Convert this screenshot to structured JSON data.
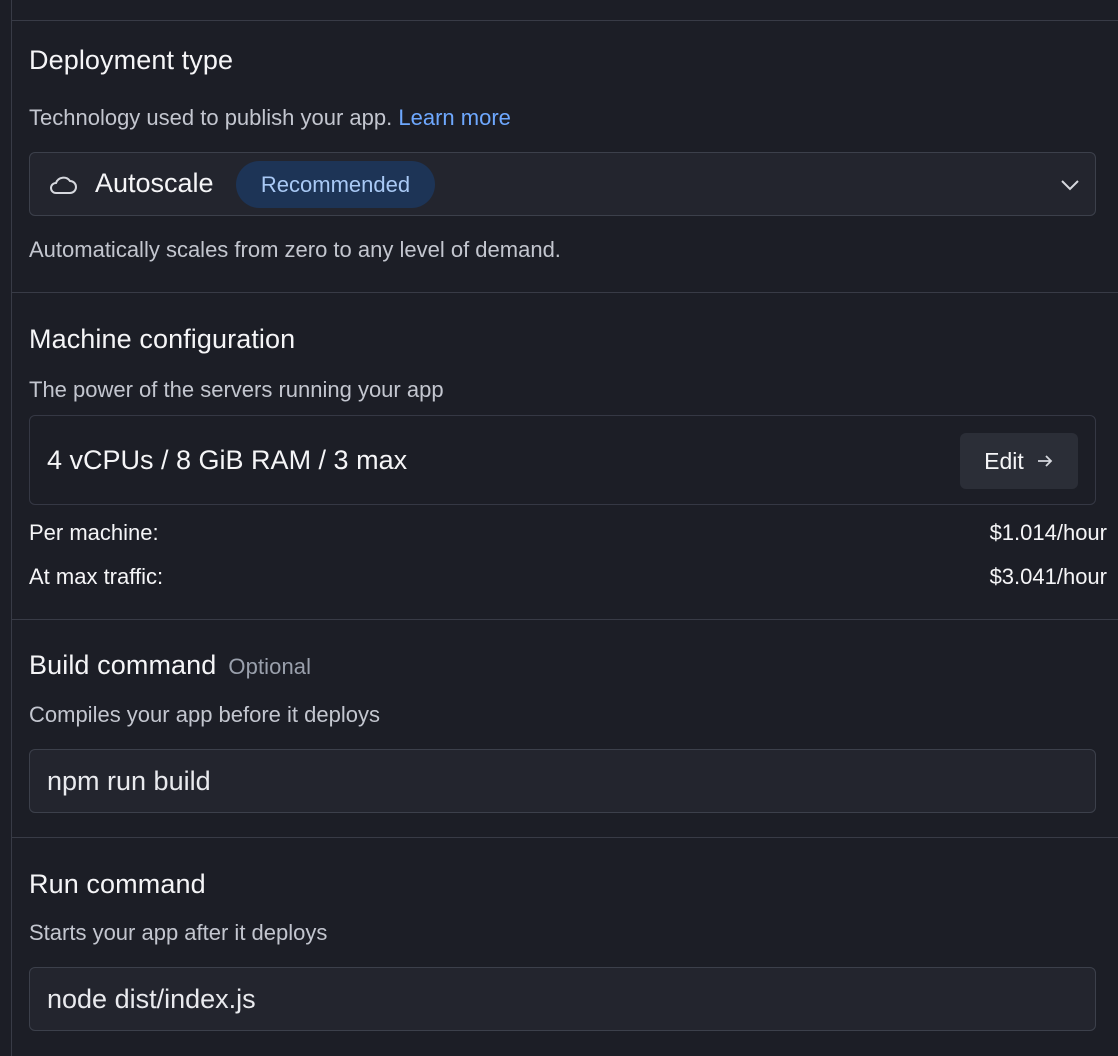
{
  "deployment": {
    "title": "Deployment type",
    "description": "Technology used to publish your app.",
    "learn_more": "Learn more",
    "selected": "Autoscale",
    "badge": "Recommended",
    "help": "Automatically scales from zero to any level of demand."
  },
  "machine": {
    "title": "Machine configuration",
    "description": "The power of the servers running your app",
    "config": "4 vCPUs / 8 GiB RAM / 3 max",
    "edit_label": "Edit",
    "per_machine_label": "Per machine:",
    "per_machine_price": "$1.014/hour",
    "max_traffic_label": "At max traffic:",
    "max_traffic_price": "$3.041/hour"
  },
  "build": {
    "title": "Build command",
    "optional": "Optional",
    "description": "Compiles your app before it deploys",
    "value": "npm run build"
  },
  "run": {
    "title": "Run command",
    "description": "Starts your app after it deploys",
    "value": "node dist/index.js"
  },
  "colors": {
    "background": "#1c1e26",
    "link": "#6ea8fe",
    "badge_bg": "#1d3456",
    "badge_text": "#a9c9f5"
  },
  "icons": [
    "cloud-icon",
    "chevron-down-icon",
    "arrow-right-icon"
  ]
}
